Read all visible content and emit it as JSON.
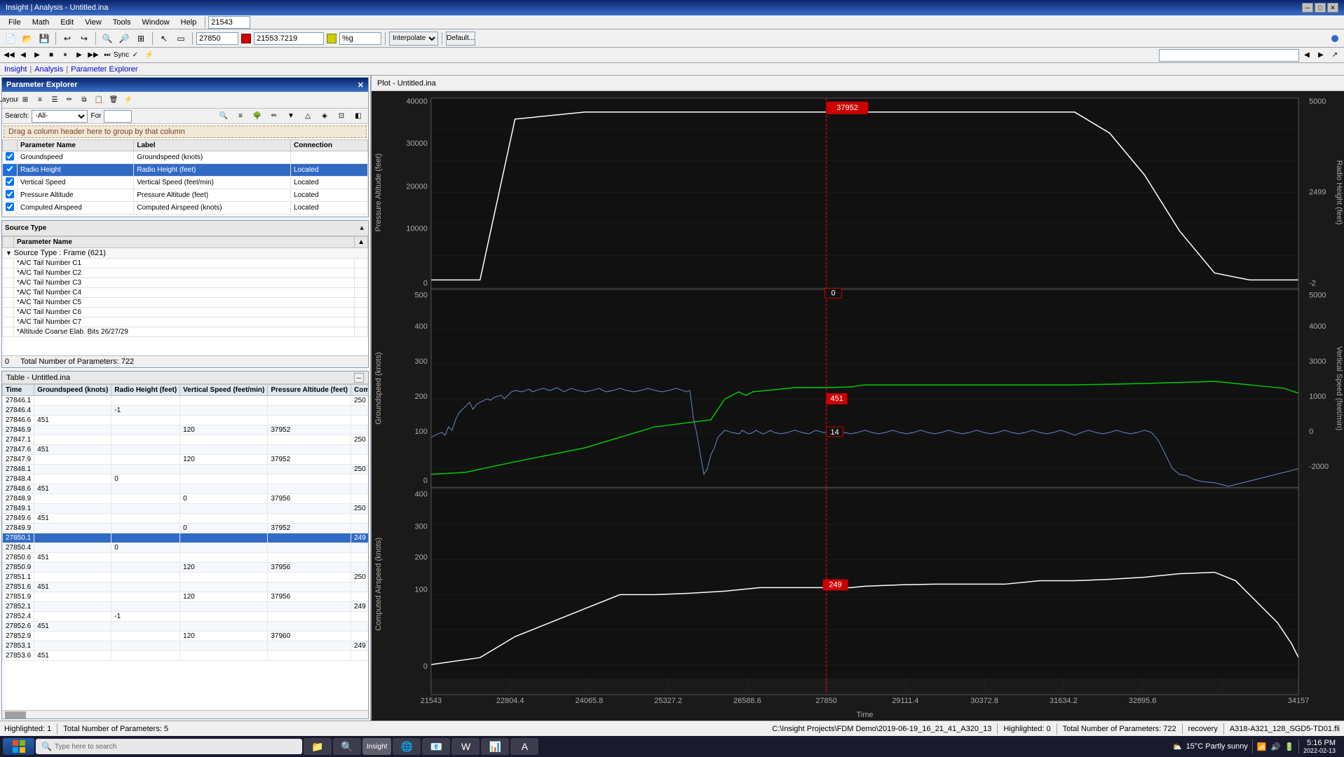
{
  "app": {
    "title": "Insight | Analysis - Untitled.ina",
    "version": "21543"
  },
  "menus": [
    "File",
    "Math",
    "Edit",
    "View",
    "Tools",
    "Window",
    "Help"
  ],
  "toolbar": {
    "time_input": "21543",
    "value_input": "27850",
    "value2_input": "21553.7219",
    "format_input": "%g",
    "interp_label": "Interpolate",
    "default_label": "Default..."
  },
  "param_explorer": {
    "title": "Parameter Explorer",
    "search_label": "Search:",
    "search_all": "-All-",
    "search_for": "For",
    "drag_header": "Drag a column header here to group by that column",
    "columns": [
      "Parameter Name",
      "Label",
      "Connection"
    ],
    "params": [
      {
        "name": "Groundspeed",
        "label": "Groundspeed (knots)",
        "connection": ""
      },
      {
        "name": "Radio Height",
        "label": "Radio Height (feet)",
        "connection": "Located"
      },
      {
        "name": "Vertical Speed",
        "label": "Vertical Speed (feet/min)",
        "connection": "Located"
      },
      {
        "name": "Pressure Altitude",
        "label": "Pressure Altitude (feet)",
        "connection": "Located"
      },
      {
        "name": "Computed Airspeed",
        "label": "Computed Airspeed (knots)",
        "connection": "Located"
      }
    ],
    "highlighted": "1",
    "total_params": "5"
  },
  "source_panel": {
    "title": "Source Type",
    "columns": [
      "Parameter Name"
    ],
    "group_label": "Source Type : Frame (621)",
    "items": [
      "*A/C Tail Number C1",
      "*A/C Tail Number C2",
      "*A/C Tail Number C3",
      "*A/C Tail Number C4",
      "*A/C Tail Number C5",
      "*A/C Tail Number C6",
      "*A/C Tail Number C7",
      "*Altitude Coarse Elab. Bits 26/27/29"
    ],
    "highlighted": "0",
    "total_params": "722"
  },
  "table": {
    "title": "Table - Untitled.ina",
    "columns": [
      "Time",
      "Groundspeed (knots)",
      "Radio Height (feet)",
      "Vertical Speed (feet/min)",
      "Pressure Altitude (feet)",
      "Computed Airspeed (knots)"
    ],
    "rows": [
      {
        "time": "27846.1",
        "gs": "",
        "rh": "",
        "vs": "",
        "pa": "",
        "ca": "250"
      },
      {
        "time": "27846.4",
        "gs": "",
        "rh": "-1",
        "vs": "",
        "pa": "",
        "ca": ""
      },
      {
        "time": "27846.6",
        "gs": "451",
        "rh": "",
        "vs": "",
        "pa": "",
        "ca": ""
      },
      {
        "time": "27846.9",
        "gs": "",
        "rh": "",
        "vs": "120",
        "pa": "37952",
        "ca": ""
      },
      {
        "time": "27847.1",
        "gs": "",
        "rh": "",
        "vs": "",
        "pa": "",
        "ca": "250"
      },
      {
        "time": "27847.6",
        "gs": "451",
        "rh": "",
        "vs": "",
        "pa": "",
        "ca": ""
      },
      {
        "time": "27847.9",
        "gs": "",
        "rh": "",
        "vs": "120",
        "pa": "37952",
        "ca": ""
      },
      {
        "time": "27848.1",
        "gs": "",
        "rh": "",
        "vs": "",
        "pa": "",
        "ca": "250"
      },
      {
        "time": "27848.4",
        "gs": "",
        "rh": "0",
        "vs": "",
        "pa": "",
        "ca": ""
      },
      {
        "time": "27848.6",
        "gs": "451",
        "rh": "",
        "vs": "",
        "pa": "",
        "ca": ""
      },
      {
        "time": "27848.9",
        "gs": "",
        "rh": "",
        "vs": "0",
        "pa": "37956",
        "ca": ""
      },
      {
        "time": "27849.1",
        "gs": "",
        "rh": "",
        "vs": "",
        "pa": "",
        "ca": "250"
      },
      {
        "time": "27849.6",
        "gs": "451",
        "rh": "",
        "vs": "",
        "pa": "",
        "ca": ""
      },
      {
        "time": "27849.9",
        "gs": "",
        "rh": "",
        "vs": "0",
        "pa": "37952",
        "ca": ""
      },
      {
        "time": "27850.1",
        "gs": "",
        "rh": "",
        "vs": "",
        "pa": "",
        "ca": "249"
      },
      {
        "time": "27850.4",
        "gs": "",
        "rh": "0",
        "vs": "",
        "pa": "",
        "ca": ""
      },
      {
        "time": "27850.6",
        "gs": "451",
        "rh": "",
        "vs": "",
        "pa": "",
        "ca": ""
      },
      {
        "time": "27850.9",
        "gs": "",
        "rh": "",
        "vs": "120",
        "pa": "37956",
        "ca": ""
      },
      {
        "time": "27851.1",
        "gs": "",
        "rh": "",
        "vs": "",
        "pa": "",
        "ca": "250"
      },
      {
        "time": "27851.6",
        "gs": "451",
        "rh": "",
        "vs": "",
        "pa": "",
        "ca": ""
      },
      {
        "time": "27851.9",
        "gs": "",
        "rh": "",
        "vs": "120",
        "pa": "37956",
        "ca": ""
      },
      {
        "time": "27852.1",
        "gs": "",
        "rh": "",
        "vs": "",
        "pa": "",
        "ca": "249"
      },
      {
        "time": "27852.4",
        "gs": "",
        "rh": "-1",
        "vs": "",
        "pa": "",
        "ca": ""
      },
      {
        "time": "27852.6",
        "gs": "451",
        "rh": "",
        "vs": "",
        "pa": "",
        "ca": ""
      },
      {
        "time": "27852.9",
        "gs": "",
        "rh": "",
        "vs": "120",
        "pa": "37960",
        "ca": ""
      },
      {
        "time": "27853.1",
        "gs": "",
        "rh": "",
        "vs": "",
        "pa": "",
        "ca": "249"
      },
      {
        "time": "27853.6",
        "gs": "451",
        "rh": "",
        "vs": "",
        "pa": "",
        "ca": ""
      }
    ]
  },
  "plot": {
    "title": "Plot - Untitled.ina",
    "cursor_time": "27850",
    "x_labels": [
      "21543",
      "22804.4",
      "24065.8",
      "25327.2",
      "26588.6",
      "27850",
      "29111.4",
      "30372.8",
      "31634.2",
      "32895.6",
      "34157"
    ],
    "x_axis_label": "Time",
    "annotations": {
      "pressure_cursor": "37952",
      "radio_cursor": "0",
      "groundspeed_cursor": "451",
      "vs_cursor": "14",
      "ca_cursor": "249"
    },
    "y_axes": {
      "left1": {
        "min": "0",
        "max": "40000",
        "label": "Pressure Altitude (feet)"
      },
      "right1": {
        "min": "-2",
        "max": "5000",
        "label": "Radio Height (feet)"
      },
      "left2": {
        "min": "0",
        "max": "500",
        "label": "Groundspeed (knots)"
      },
      "right2": {
        "min": "-2000",
        "max": "5000",
        "label": "Vertical Speed (feet/min)"
      },
      "left3": {
        "min": "0",
        "max": "400",
        "label": "Computed Airspeed (knots)"
      }
    }
  },
  "status_bar": {
    "left_highlighted": "Highlighted: 1",
    "left_total": "Total Number of Parameters: 5",
    "right_highlighted": "Highlighted: 0",
    "right_total": "Total Number of Parameters: 722",
    "file_path": "C:\\Insight Projects\\FDM Demo\\2019-06-19_16_21_41_A320_13",
    "recovery": "recovery",
    "aircraft": "A318-A321_128_SGD5-TD01.fli"
  },
  "taskbar": {
    "search_placeholder": "Type here to search",
    "time": "5:16 PM",
    "date": "2022-02-13",
    "temperature": "15°C  Partly sunny"
  }
}
